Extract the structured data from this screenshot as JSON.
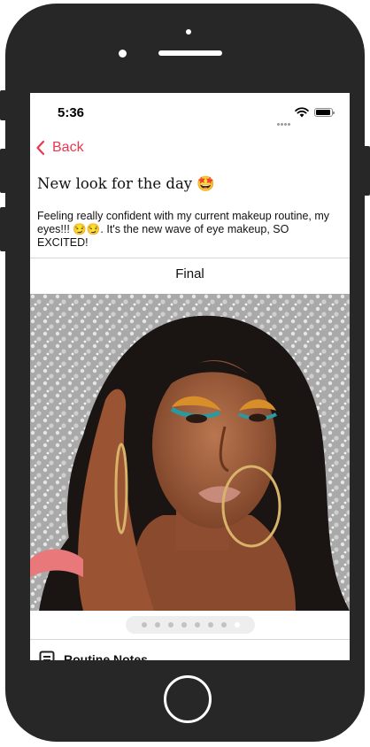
{
  "status_bar": {
    "time": "5:36"
  },
  "nav": {
    "back_label": "Back"
  },
  "post": {
    "title": "New look for the day 🤩",
    "description": "Feeling really confident with my current makeup routine, my eyes!!! 😏😏. It's the new wave of eye makeup, SO EXCITED!"
  },
  "gallery": {
    "section_label": "Final",
    "page_count": 8,
    "active_page": 8
  },
  "notes": {
    "label": "Routine Notes"
  },
  "colors": {
    "accent": "#e8384f",
    "phone_frame": "#272727"
  }
}
